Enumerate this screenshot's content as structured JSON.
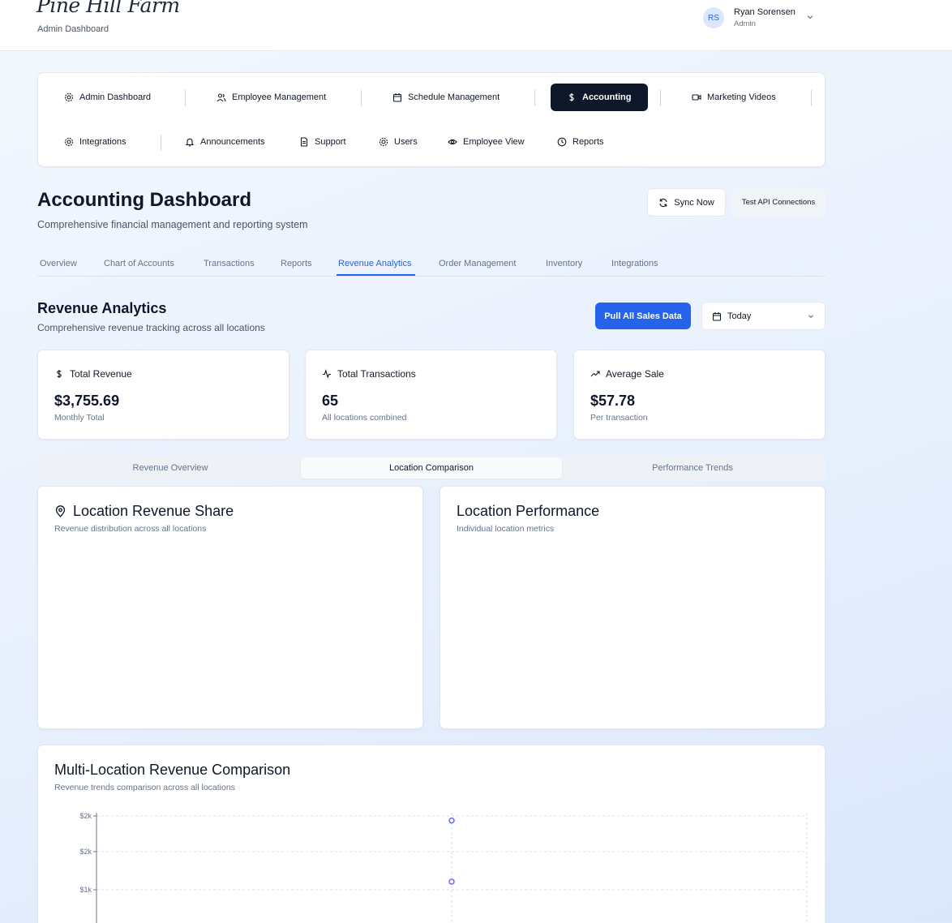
{
  "header": {
    "logo_text": "Pine Hill Farm",
    "subtitle": "Admin Dashboard",
    "user": {
      "initials": "RS",
      "name": "Ryan Sorensen",
      "role": "Admin"
    }
  },
  "nav": {
    "row1": [
      {
        "label": "Admin Dashboard",
        "icon": "gear-icon"
      },
      {
        "label": "Employee Management",
        "icon": "users-icon"
      },
      {
        "label": "Schedule Management",
        "icon": "calendar-icon"
      },
      {
        "label": "Accounting",
        "icon": "dollar-icon",
        "active": true
      },
      {
        "label": "Marketing Videos",
        "icon": "video-icon"
      }
    ],
    "row2": [
      {
        "label": "Integrations",
        "icon": "gear-icon"
      },
      {
        "label": "Announcements",
        "icon": "bell-icon"
      },
      {
        "label": "Support",
        "icon": "document-icon"
      },
      {
        "label": "Users",
        "icon": "gear-icon"
      },
      {
        "label": "Employee View",
        "icon": "eye-icon"
      },
      {
        "label": "Reports",
        "icon": "clock-icon"
      }
    ]
  },
  "page": {
    "title": "Accounting Dashboard",
    "subtitle": "Comprehensive financial management and reporting system",
    "sync_label": "Sync Now",
    "test_label": "Test API Connections"
  },
  "tabs": [
    "Overview",
    "Chart of Accounts",
    "Transactions",
    "Reports",
    "Revenue Analytics",
    "Order Management",
    "Inventory",
    "Integrations"
  ],
  "active_tab": "Revenue Analytics",
  "revenue": {
    "title": "Revenue Analytics",
    "subtitle": "Comprehensive revenue tracking across all locations",
    "pull_label": "Pull All Sales Data",
    "date_value": "Today"
  },
  "stats": [
    {
      "label": "Total Revenue",
      "icon": "dollar-icon",
      "value": "$3,755.69",
      "note": "Monthly Total"
    },
    {
      "label": "Total Transactions",
      "icon": "activity-icon",
      "value": "65",
      "note": "All locations combined"
    },
    {
      "label": "Average Sale",
      "icon": "trending-up-icon",
      "value": "$57.78",
      "note": "Per transaction"
    }
  ],
  "segments": [
    "Revenue Overview",
    "Location Comparison",
    "Performance Trends"
  ],
  "active_segment": "Location Comparison",
  "panels": {
    "share": {
      "title": "Location Revenue Share",
      "subtitle": "Revenue distribution across all locations",
      "icon": "map-pin-icon"
    },
    "performance": {
      "title": "Location Performance",
      "subtitle": "Individual location metrics"
    },
    "comparison": {
      "title": "Multi-Location Revenue Comparison",
      "subtitle": "Revenue trends comparison across all locations"
    }
  },
  "colors": {
    "accent": "#2563eb",
    "active_nav": "#0f172a",
    "series_a": "#8b5cf6",
    "series_b": "#6366f1"
  },
  "chart_data": {
    "type": "line",
    "yticks": [
      "$2k",
      "$2k",
      "$1k"
    ],
    "ylim": [
      0,
      2000
    ],
    "grid": true,
    "series": [
      {
        "points": [
          {
            "x": 0,
            "y": 1950
          }
        ],
        "color": "#6366f1"
      },
      {
        "points": [
          {
            "x": 0,
            "y": 1130
          }
        ],
        "color": "#8b5cf6"
      }
    ]
  }
}
